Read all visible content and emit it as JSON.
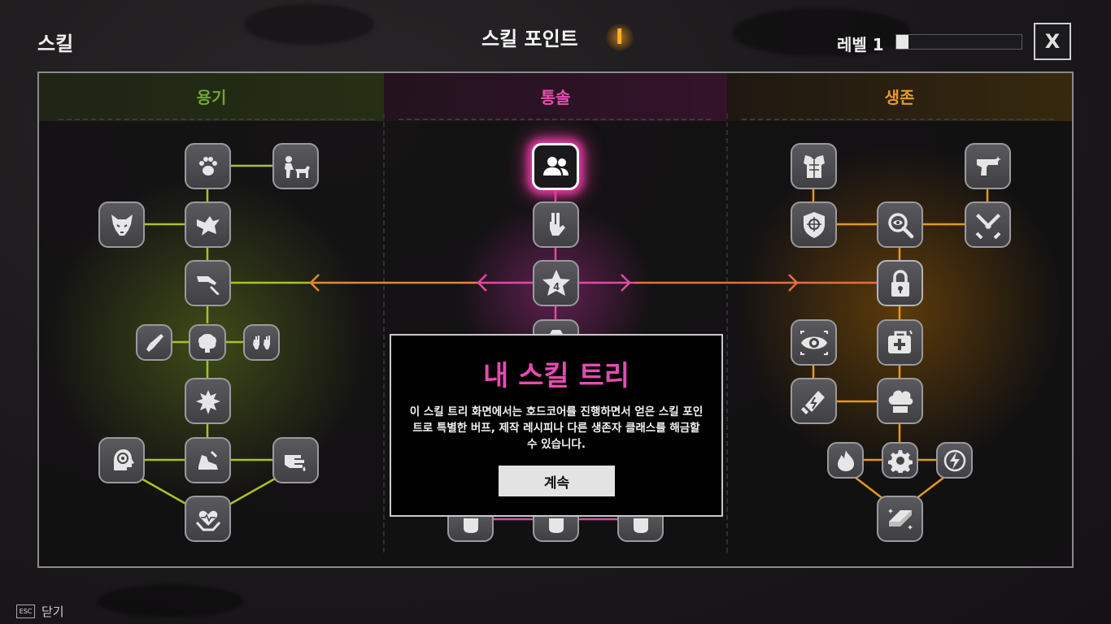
{
  "screen": {
    "title": "스킬",
    "skill_points_label": "스킬 포인트",
    "skill_points_value": "I",
    "level_label": "레벨 1",
    "xp_progress_fraction": 0.1,
    "close_label": "X"
  },
  "columns": [
    {
      "title": "용기",
      "color": "#6ea531",
      "glow": "#8fb520"
    },
    {
      "title": "통솔",
      "color": "#e84db2",
      "glow": "#a22a86"
    },
    {
      "title": "생존",
      "color": "#e39a2c",
      "glow": "#b76e00"
    }
  ],
  "branch_counter": "4",
  "modal": {
    "title": "내 스킬 트리",
    "body_line1": "이 스킬 트리 화면에서는 호드코어를 진행하면서 얻은 스킬 포인",
    "body_line2": "트로 특별한 버프, 제작 레시피나 다른 생존자 클래스를 해금할",
    "body_line3": "수 있습니다.",
    "button_label": "계속"
  },
  "footer": {
    "key_label": "ESC",
    "action_label": "닫기"
  },
  "icons": {
    "courage": [
      "paw-icon",
      "dog-handler-icon",
      "wolf-icon",
      "dove-icon",
      "knife-hand-icon",
      "blade-icon",
      "brain-icon",
      "raised-hands-icon",
      "explosion-brain-icon",
      "mind-target-icon",
      "running-shoe-icon",
      "dripping-hand-icon",
      "heart-hands-icon"
    ],
    "leadership": [
      "group-icon",
      "peace-hand-icon",
      "star-counter-icon",
      "backpack-icon"
    ],
    "survival": [
      "armor-icon",
      "pistol-icon",
      "shield-icon",
      "search-icon",
      "swords-icon",
      "lock-icon",
      "eye-icon",
      "medkit-icon",
      "battery-icon",
      "chef-hat-icon",
      "fire-icon",
      "gear-icon",
      "lightning-icon",
      "metal-bar-icon"
    ]
  }
}
